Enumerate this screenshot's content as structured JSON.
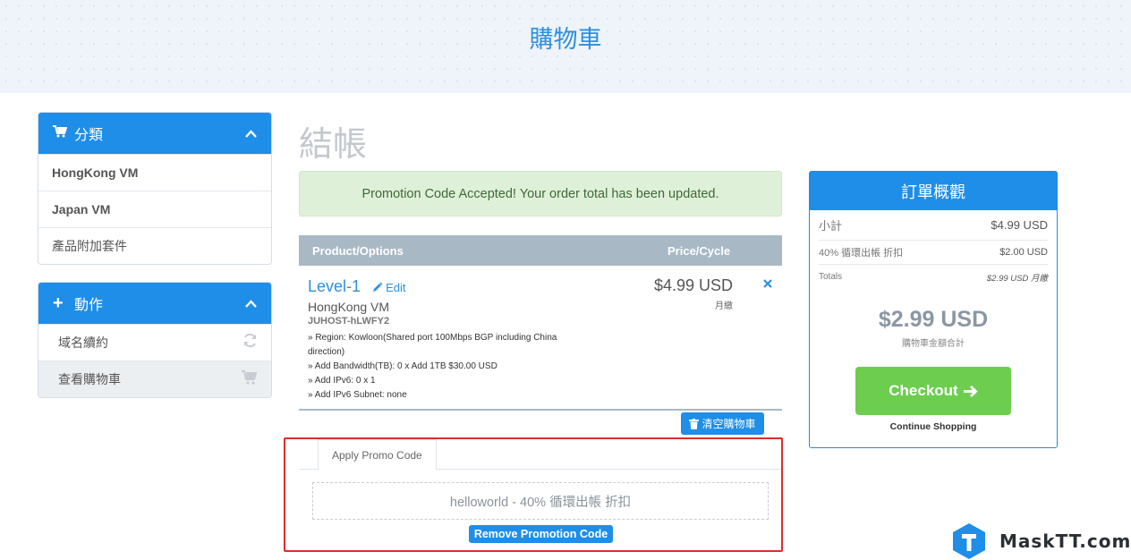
{
  "header": {
    "title": "購物車"
  },
  "sidebar": {
    "categories": {
      "title": "分類",
      "items": [
        {
          "label": "HongKong VM"
        },
        {
          "label": "Japan VM"
        },
        {
          "label": "產品附加套件"
        }
      ]
    },
    "actions": {
      "title": "動作",
      "items": [
        {
          "label": "域名續約",
          "icon": "refresh-icon"
        },
        {
          "label": "查看購物車",
          "icon": "cart-icon"
        }
      ]
    }
  },
  "main": {
    "title": "結帳",
    "alert": "Promotion Code Accepted! Your order total has been updated.",
    "table": {
      "col_product": "Product/Options",
      "col_price": "Price/Cycle",
      "item": {
        "name": "Level-1",
        "edit": "Edit",
        "group": "HongKong VM",
        "domain": "JUHOST-hLWFY2",
        "options": [
          "» Region: Kowloon(Shared port 100Mbps BGP including China direction)",
          "» Add Bandwidth(TB): 0 x Add 1TB $30.00 USD",
          "» Add IPv6: 0 x 1",
          "» Add IPv6 Subnet: none"
        ],
        "price": "$4.99 USD",
        "cycle": "月繳"
      }
    },
    "empty_cart": "清空購物車",
    "promo": {
      "tab": "Apply Promo Code",
      "applied": "helloworld - 40% 循環出帳 折扣",
      "remove": "Remove Promotion Code"
    }
  },
  "summary": {
    "title": "訂單概觀",
    "subtotal_label": "小計",
    "subtotal_value": "$4.99 USD",
    "discount_label": "40% 循環出帳 折扣",
    "discount_value": "$2.00 USD",
    "totals_label": "Totals",
    "totals_value": "$2.99 USD 月繳",
    "total_big": "$2.99 USD",
    "total_caption": "購物車金額合計",
    "checkout": "Checkout",
    "continue": "Continue Shopping"
  },
  "watermark": {
    "text": "MaskTT.com"
  },
  "colors": {
    "primary": "#1e8ee8",
    "success": "#6ccd4f",
    "alert_bg": "#dff0d8",
    "danger_outline": "#e02b2b"
  }
}
